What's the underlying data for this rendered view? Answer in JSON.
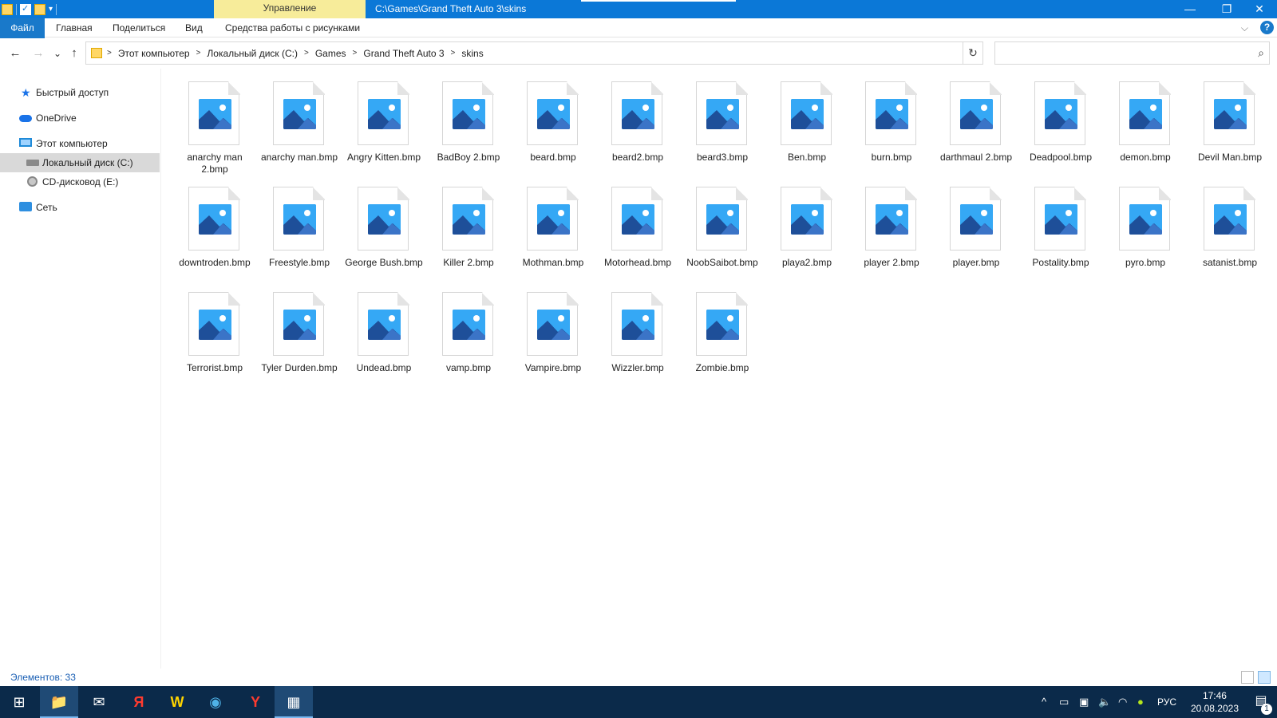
{
  "titlebar": {
    "manage_tab": "Управление",
    "path": "C:\\Games\\Grand Theft Auto 3\\skins",
    "minimize": "—",
    "restore": "❐",
    "close": "✕"
  },
  "ribbon": {
    "tabs": [
      "Файл",
      "Главная",
      "Поделиться",
      "Вид",
      "Средства работы с рисунками"
    ],
    "chevron": "⌵",
    "help": "?"
  },
  "nav": {
    "back": "←",
    "forward": "→",
    "recent": "⌄",
    "up": "↑",
    "breadcrumb": [
      "Этот компьютер",
      "Локальный диск (C:)",
      "Games",
      "Grand Theft Auto 3",
      "skins"
    ],
    "breadcrumb_sep": ">",
    "dropdown": "⌄",
    "refresh": "↻",
    "search_placeholder": "",
    "search_glyph": "⌕"
  },
  "sidebar": {
    "items": [
      {
        "label": "Быстрый доступ",
        "icon": "star-icon"
      },
      {
        "label": "OneDrive",
        "icon": "cloud-icon"
      },
      {
        "label": "Этот компьютер",
        "icon": "computer-icon"
      },
      {
        "label": "Локальный диск (C:)",
        "icon": "disk-icon",
        "selected": true
      },
      {
        "label": "CD-дисковод (E:)",
        "icon": "cd-drive-icon"
      },
      {
        "label": "Сеть",
        "icon": "network-icon"
      }
    ]
  },
  "files": [
    "anarchy man 2.bmp",
    "anarchy man.bmp",
    "Angry Kitten.bmp",
    "BadBoy 2.bmp",
    "beard.bmp",
    "beard2.bmp",
    "beard3.bmp",
    "Ben.bmp",
    "burn.bmp",
    "darthmaul 2.bmp",
    "Deadpool.bmp",
    "demon.bmp",
    "Devil Man.bmp",
    "downtroden.bmp",
    "Freestyle.bmp",
    "George Bush.bmp",
    "Killer 2.bmp",
    "Mothman.bmp",
    "Motorhead.bmp",
    "NoobSaibot.bmp",
    "playa2.bmp",
    "player 2.bmp",
    "player.bmp",
    "Postality.bmp",
    "pyro.bmp",
    "satanist.bmp",
    "Terrorist.bmp",
    "Tyler Durden.bmp",
    "Undead.bmp",
    "vamp.bmp",
    "Vampire.bmp",
    "Wizzler.bmp",
    "Zombie.bmp"
  ],
  "status": {
    "items_count": "Элементов: 33"
  },
  "taskbar": {
    "apps": [
      {
        "name": "start-icon",
        "glyph": "⊞"
      },
      {
        "name": "file-explorer-icon",
        "glyph": "📁",
        "active": true
      },
      {
        "name": "mail-icon",
        "glyph": "✉"
      },
      {
        "name": "yandex-icon",
        "glyph": "Я"
      },
      {
        "name": "app-w-icon",
        "glyph": "W"
      },
      {
        "name": "app-globe-icon",
        "glyph": "◉"
      },
      {
        "name": "yandex-browser-icon",
        "glyph": "Y"
      },
      {
        "name": "game-icon",
        "glyph": "▦",
        "active": true
      }
    ],
    "tray": {
      "lang": "РУС",
      "time": "17:46",
      "date": "20.08.2023",
      "notification_count": "1"
    }
  },
  "colors": {
    "titlebar": "#0b78d7",
    "manage_tab": "#f7ec9a",
    "selection": "#d9d9d9",
    "taskbar": "#0b2a4a"
  }
}
